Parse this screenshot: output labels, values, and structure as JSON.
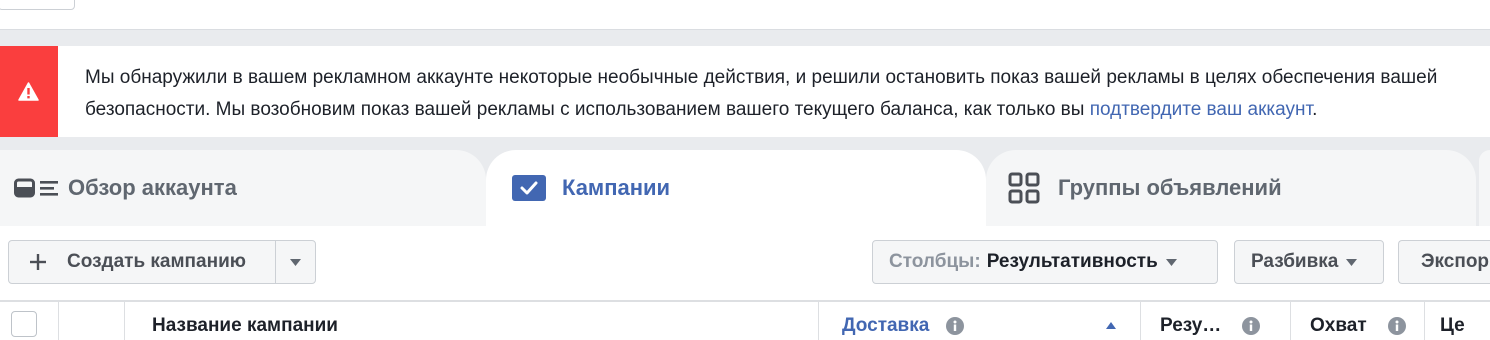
{
  "colors": {
    "accent": "#4267b2",
    "alert": "#fa3e3e",
    "text": "#1d2129",
    "muted": "#606770",
    "page_bg": "#e9ebee"
  },
  "alert": {
    "icon": "warning-icon",
    "line1": "Мы обнаружили в вашем рекламном аккаунте некоторые необычные действия, и решили остановить показ вашей рекламы в целях обеспечения вашей",
    "line2": "безопасности. Мы возобновим показ вашей рекламы с использованием вашего текущего баланса, как только вы",
    "link": "подтвердите ваш аккаунт",
    "suffix": "."
  },
  "tabs": [
    {
      "label": "Обзор аккаунта",
      "icon": "account-overview-icon",
      "active": false
    },
    {
      "label": "Кампании",
      "icon": "campaigns-checkbox-icon",
      "active": true
    },
    {
      "label": "Группы объявлений",
      "icon": "ad-sets-grid-icon",
      "active": false
    }
  ],
  "toolbar": {
    "create": {
      "icon": "plus-icon",
      "label": "Создать кампанию",
      "caret_icon": "chevron-down-icon"
    },
    "columns": {
      "prefix": "Столбцы:",
      "value": "Результативность",
      "caret_icon": "chevron-down-icon"
    },
    "breakdown": {
      "label": "Разбивка",
      "caret_icon": "chevron-down-icon"
    },
    "export": {
      "label": "Экспор"
    }
  },
  "table": {
    "columns": [
      {
        "label": "Название кампании"
      },
      {
        "label": "Доставка",
        "info_icon": "info-icon",
        "sort_icon": "sort-ascending-icon"
      },
      {
        "label": "Резу…",
        "info_icon": "info-icon"
      },
      {
        "label": "Охват",
        "info_icon": "info-icon"
      },
      {
        "label": "Це"
      }
    ]
  }
}
